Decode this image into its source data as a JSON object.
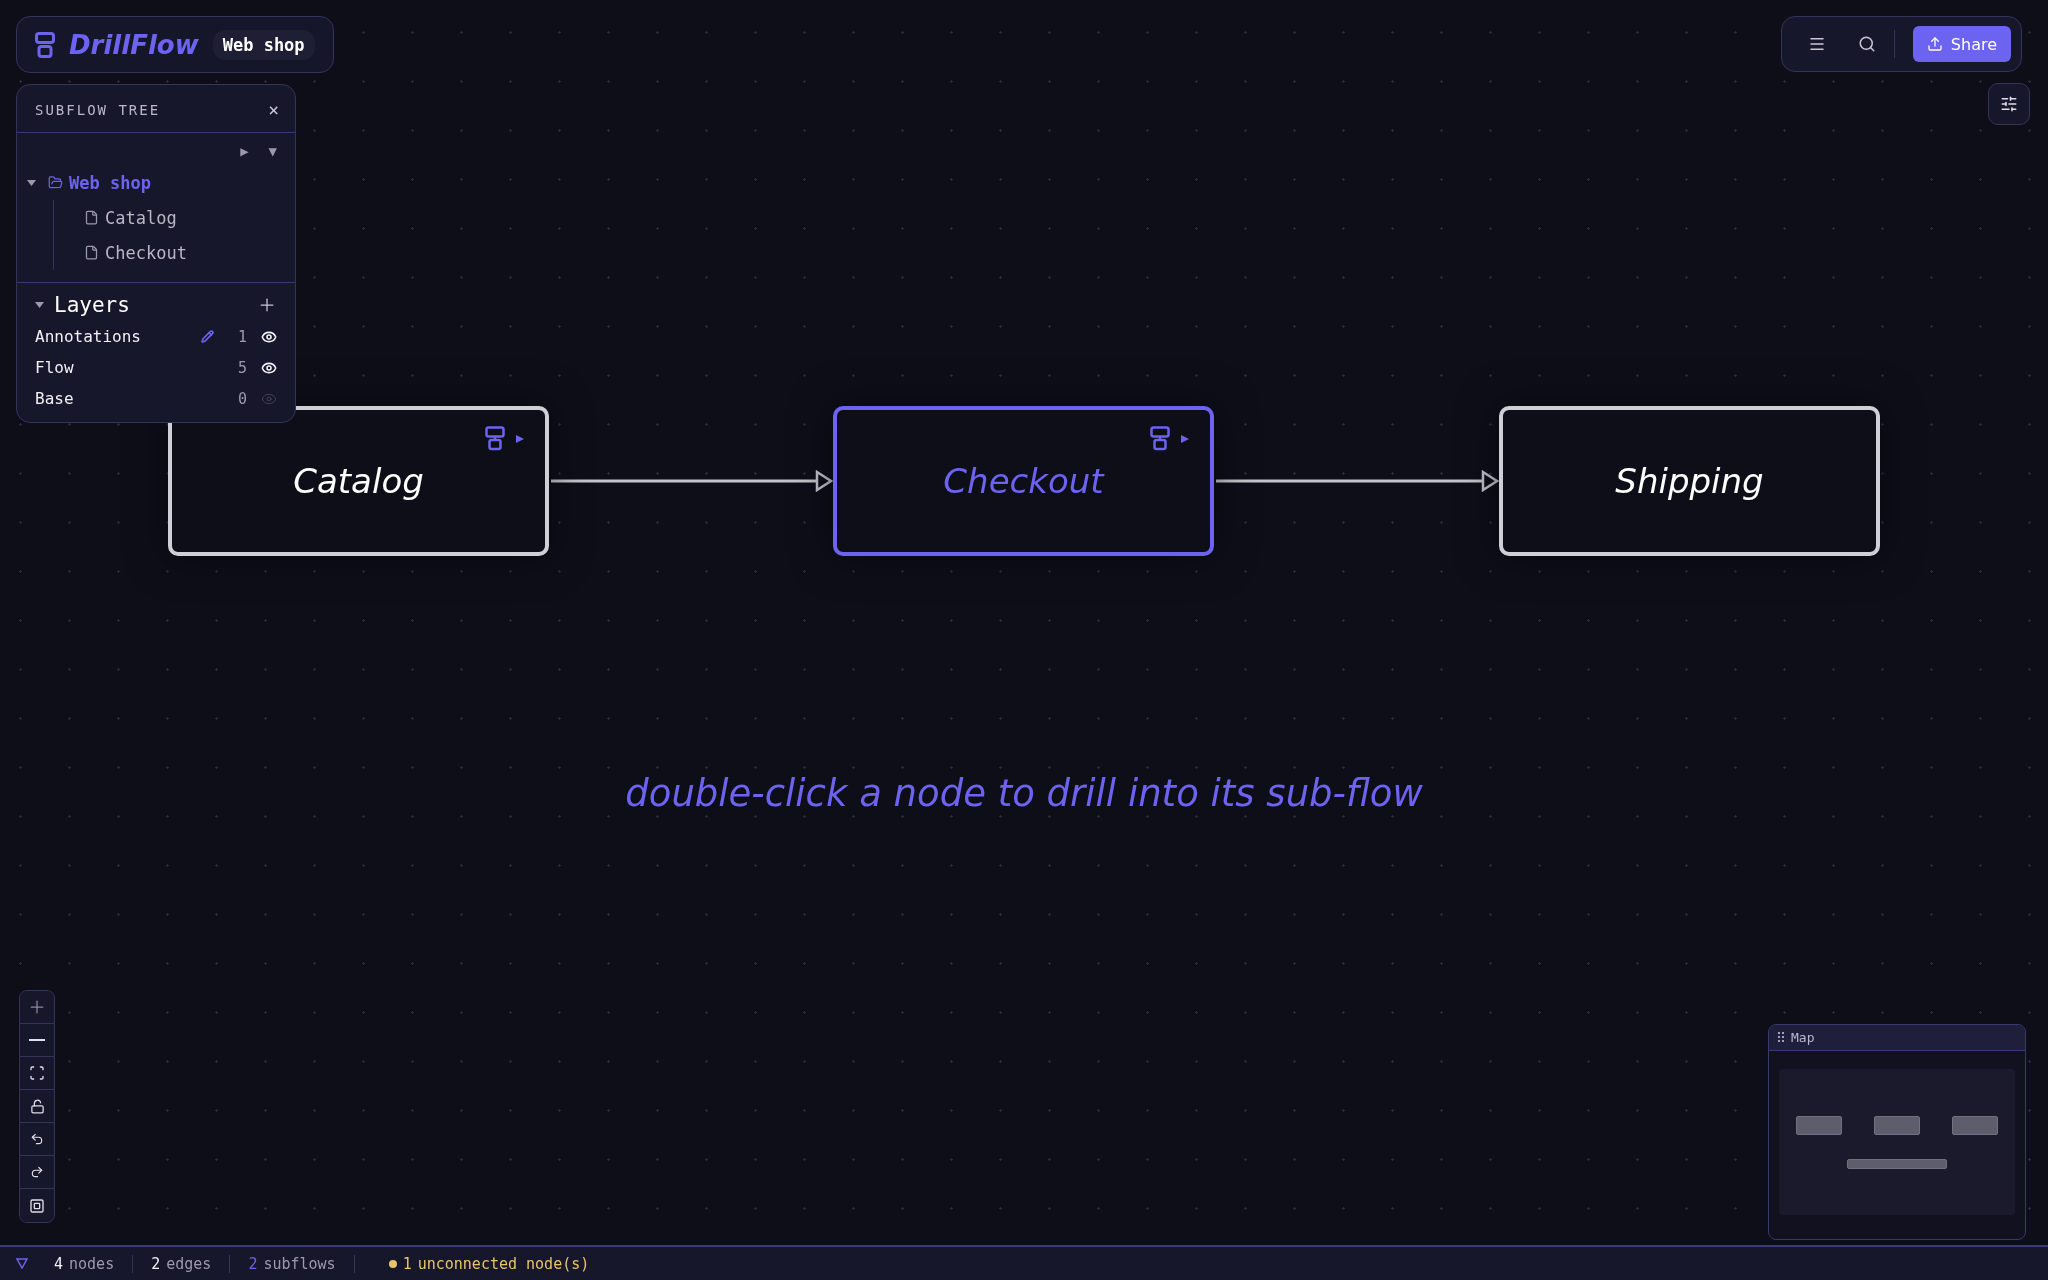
{
  "brand": {
    "name": "DrillFlow",
    "breadcrumb": "Web shop"
  },
  "subflow_tree": {
    "title": "SUBFLOW TREE",
    "close": "×",
    "controls": [
      "▶",
      "▼"
    ],
    "items": [
      {
        "label": "Web shop",
        "kind": "folder",
        "expanded": true,
        "selected": true,
        "children": [
          {
            "label": "Catalog",
            "kind": "file",
            "selected": false
          },
          {
            "label": "Checkout",
            "kind": "file",
            "selected": false
          }
        ]
      }
    ]
  },
  "layers": {
    "title": "Layers",
    "expanded": true,
    "items": [
      {
        "name": "Annotations",
        "count": "1",
        "visible": true,
        "active": true
      },
      {
        "name": "Flow",
        "count": "5",
        "visible": true,
        "active": false
      },
      {
        "name": "Base",
        "count": "0",
        "visible": false,
        "active": false
      }
    ]
  },
  "toolbar": {
    "share": "Share"
  },
  "nodes": [
    {
      "label": "Catalog",
      "selected": false,
      "has_subflow": true
    },
    {
      "label": "Checkout",
      "selected": true,
      "has_subflow": true
    },
    {
      "label": "Shipping",
      "selected": false,
      "has_subflow": false
    }
  ],
  "edges": [
    {
      "kind": "arrow"
    },
    {
      "kind": "arrow"
    }
  ],
  "annotation": "double-click a node to drill into its sub-flow",
  "map": {
    "title": "Map"
  },
  "status_bar": [
    {
      "count": "4",
      "label": "nodes",
      "kind": "plain"
    },
    {
      "count": "2",
      "label": "edges",
      "kind": "plain"
    },
    {
      "count": "2",
      "label": "subflows",
      "kind": "accent"
    },
    {
      "count": "1",
      "label": "unconnected node(s)",
      "kind": "warning"
    }
  ]
}
